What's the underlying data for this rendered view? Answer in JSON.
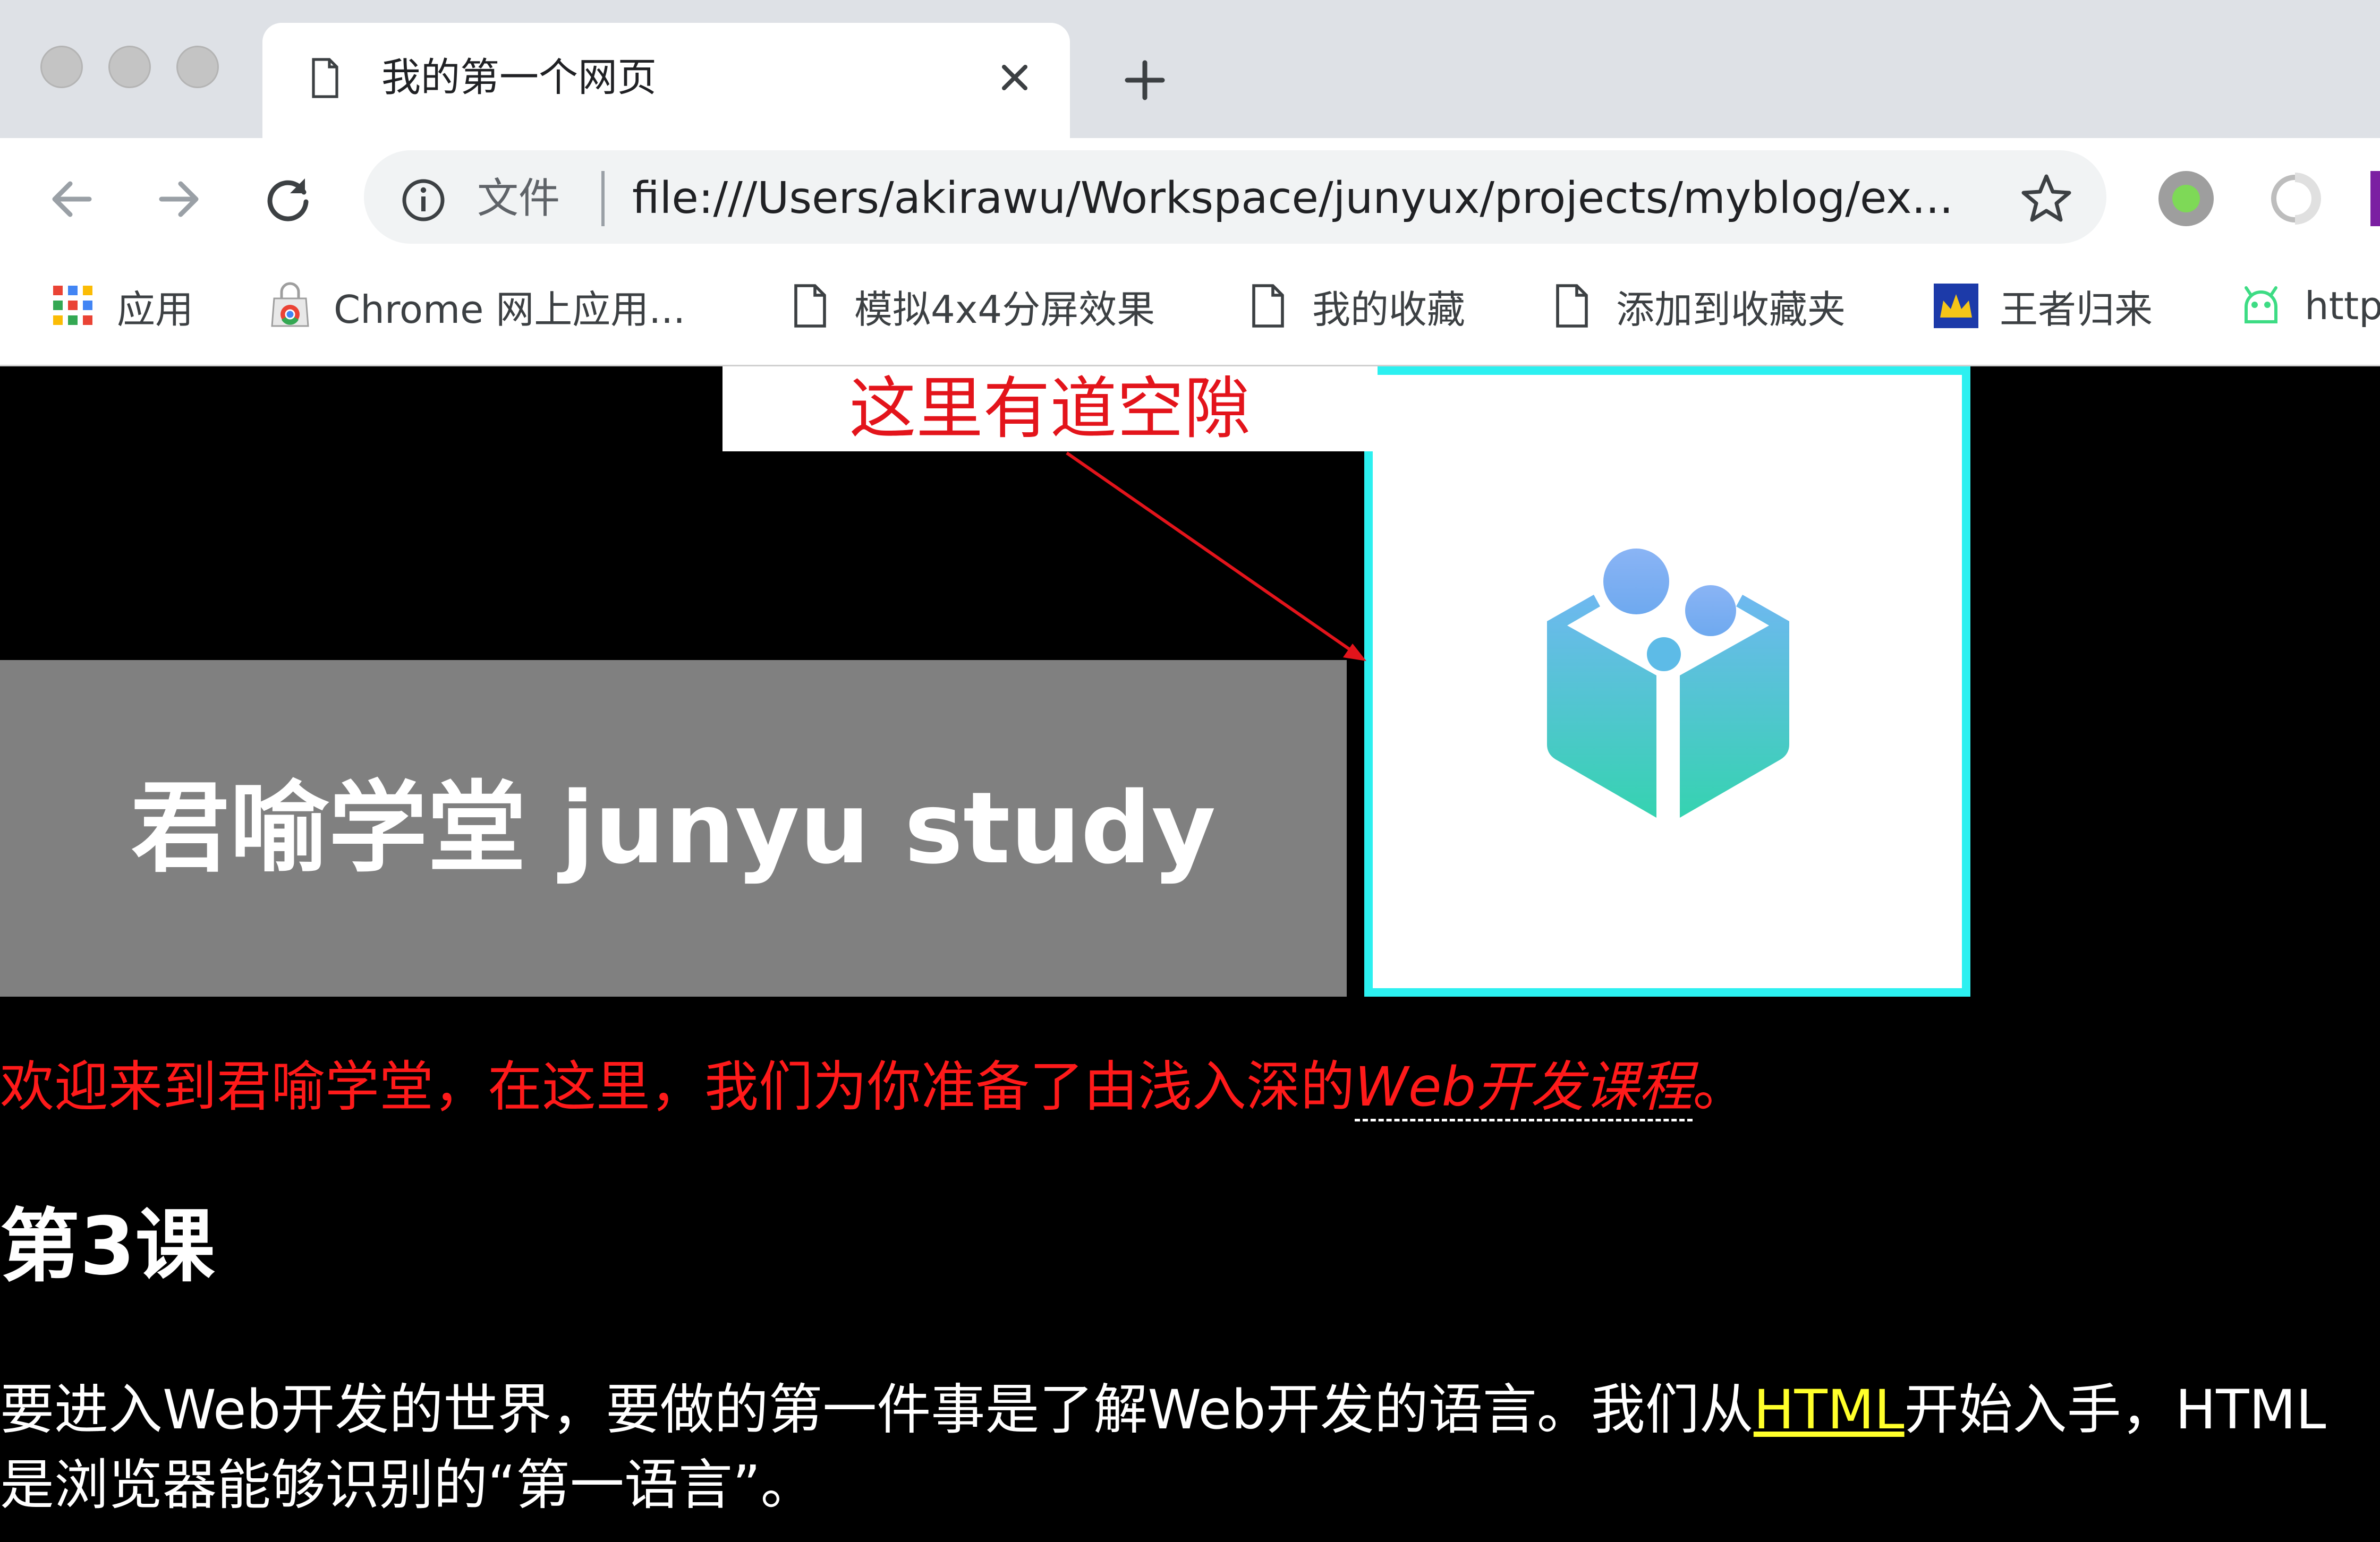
{
  "browser": {
    "tab": {
      "title": "我的第一个网页"
    },
    "omnibox": {
      "security_label": "文件",
      "url": "file:///Users/akirawu/Workspace/junyux/projects/myblog/ex..."
    },
    "bookmarks": [
      {
        "label": "应用",
        "icon": "apps-grid-icon"
      },
      {
        "label": "Chrome 网上应用...",
        "icon": "chrome-webstore-icon"
      },
      {
        "label": "模拟4x4分屏效果",
        "icon": "page-icon"
      },
      {
        "label": "我的收藏",
        "icon": "page-icon"
      },
      {
        "label": "添加到收藏夹",
        "icon": "page-icon"
      },
      {
        "label": "王者归来",
        "icon": "crown-icon"
      },
      {
        "label": "http",
        "icon": "android-icon"
      }
    ]
  },
  "annotation": {
    "text": "这里有道空隙",
    "color": "#e3141b"
  },
  "page": {
    "banner_title": "君喻学堂 junyu study",
    "welcome": {
      "prefix": "欢迎来到君喻学堂，在这里，我们为你准备了由浅入深的",
      "link": "Web开发课程",
      "suffix": "。"
    },
    "lesson_title": "第3课",
    "paragraph": {
      "prefix": "要进入Web开发的世界，要做的第一件事是了解Web开发的语言。我们从",
      "link": "HTML",
      "suffix": "开始入手，HTML是浏览器能够识别的“第一语言”。"
    }
  },
  "colors": {
    "page_background": "#000000",
    "banner_background": "#808080",
    "logo_border": "#2cf0f0",
    "welcome_text": "#ff1a1a",
    "html_link": "#ffff2a"
  }
}
